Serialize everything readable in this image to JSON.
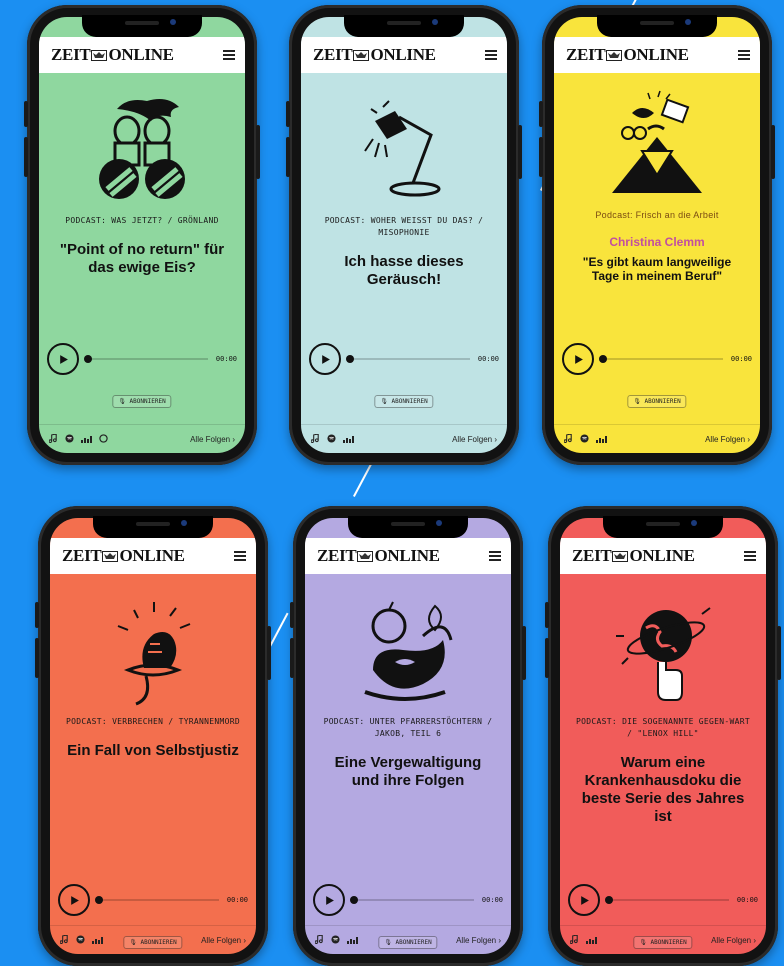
{
  "brand": {
    "logo_left": "ZEIT",
    "logo_right": "ONLINE"
  },
  "common": {
    "subscribe": "ABONNIEREN",
    "all_episodes": "Alle Folgen",
    "time": "00:00"
  },
  "cards": [
    {
      "bg": "#8fd79f",
      "kicker": "PODCAST: WAS JETZT? / GRÖNLAND",
      "subtitle": "",
      "title": "\"Point of no return\" für das ewige Eis?",
      "illustration": "binoculars-illustration",
      "footer_icons": [
        "music-icon",
        "spotify-icon",
        "deezer-icon",
        "podcast-icon"
      ]
    },
    {
      "bg": "#bfe3e4",
      "kicker": "PODCAST: WOHER WEISST DU DAS? / MISOPHONIE",
      "subtitle": "",
      "title": "Ich hasse dieses Geräusch!",
      "illustration": "desk-lamp-illustration",
      "footer_icons": [
        "music-icon",
        "spotify-icon",
        "deezer-icon"
      ]
    },
    {
      "bg": "#f9e43c",
      "kicker": "Podcast: Frisch an die Arbeit",
      "subtitle": "Christina Clemm",
      "title": "\"Es gibt kaum langweilige Tage in meinem Beruf\"",
      "illustration": "mountain-objects-illustration",
      "footer_icons": [
        "music-icon",
        "spotify-icon",
        "deezer-icon"
      ]
    },
    {
      "bg": "#f36f4e",
      "kicker": "PODCAST: VERBRECHEN / TYRANNENMORD",
      "subtitle": "",
      "title": "Ein Fall von Selbstjustiz",
      "illustration": "head-on-plate-illustration",
      "footer_icons": [
        "music-icon",
        "spotify-icon",
        "deezer-icon"
      ]
    },
    {
      "bg": "#b4a9e1",
      "kicker": "PODCAST: UNTER PFARRERSTÖCHTERN / JAKOB, TEIL 6",
      "subtitle": "",
      "title": "Eine Vergewaltigung und ihre Folgen",
      "illustration": "snake-apple-illustration",
      "footer_icons": [
        "music-icon",
        "spotify-icon",
        "deezer-icon"
      ]
    },
    {
      "bg": "#f15c5a",
      "kicker": "PODCAST: DIE SOGENANNTE GEGEN-WART / \"LENOX HILL\"",
      "subtitle": "",
      "title": "Warum eine Krankenhausdoku die beste Serie des Jahres ist",
      "illustration": "globe-finger-illustration",
      "footer_icons": [
        "music-icon",
        "deezer-icon"
      ]
    }
  ]
}
